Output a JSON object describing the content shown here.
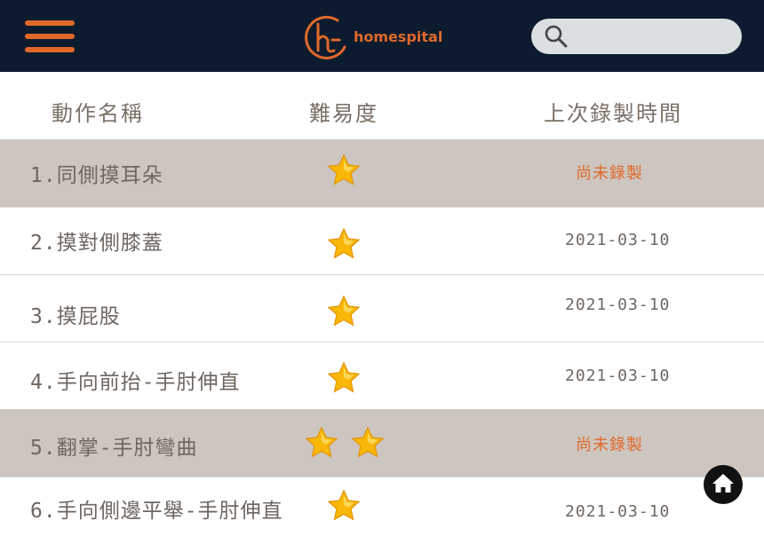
{
  "header": {
    "brand": "homespital",
    "logo_mark": "ht",
    "menu_icon": "hamburger-menu-icon",
    "search": {
      "icon": "search-icon",
      "placeholder": ""
    }
  },
  "table": {
    "headers": {
      "name": "動作名稱",
      "difficulty": "難易度",
      "last_recorded": "上次錄製時間"
    },
    "rows": [
      {
        "name": "1.同側摸耳朵",
        "stars": 1,
        "date": "尚未錄製",
        "pending": true
      },
      {
        "name": "2.摸對側膝蓋",
        "stars": 1,
        "date": "2021-03-10",
        "pending": false
      },
      {
        "name": "3.摸屁股",
        "stars": 1,
        "date": "2021-03-10",
        "pending": false
      },
      {
        "name": "4.手向前抬-手肘伸直",
        "stars": 1,
        "date": "2021-03-10",
        "pending": false
      },
      {
        "name": "5.翻掌-手肘彎曲",
        "stars": 2,
        "date": "尚未錄製",
        "pending": true
      },
      {
        "name": "6.手向側邊平舉-手肘伸直",
        "stars": 1,
        "date": "2021-03-10",
        "pending": false
      }
    ]
  },
  "home_button": {
    "icon": "home-icon"
  },
  "colors": {
    "topbar": "#0d1b2e",
    "accent": "#e0692a",
    "highlight_row": "#cdc6c0",
    "text": "#6e6660",
    "search_bg": "#dcdfe2"
  }
}
